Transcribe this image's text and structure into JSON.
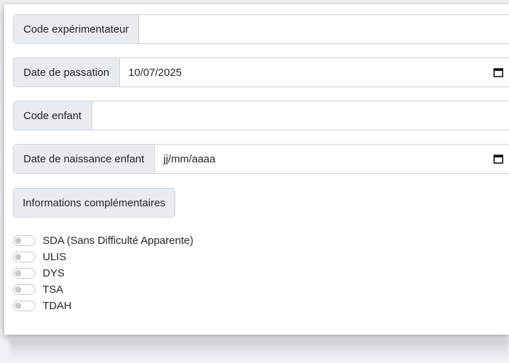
{
  "form": {
    "experimenter": {
      "label": "Code expérimentateur",
      "value": ""
    },
    "session_date": {
      "label": "Date de passation",
      "value": "10/07/2025"
    },
    "child_code": {
      "label": "Code enfant",
      "value": ""
    },
    "birth_date": {
      "label": "Date de naissance enfant",
      "value": "jj/mm/aaaa"
    }
  },
  "info_button": {
    "label": "Informations complémentaires"
  },
  "toggles": [
    {
      "label": "SDA (Sans Difficulté Apparente)",
      "checked": false
    },
    {
      "label": "ULIS",
      "checked": false
    },
    {
      "label": "DYS",
      "checked": false
    },
    {
      "label": "TSA",
      "checked": false
    },
    {
      "label": "TDAH",
      "checked": false
    }
  ],
  "icons": {
    "date_picker": "calendar-icon"
  }
}
